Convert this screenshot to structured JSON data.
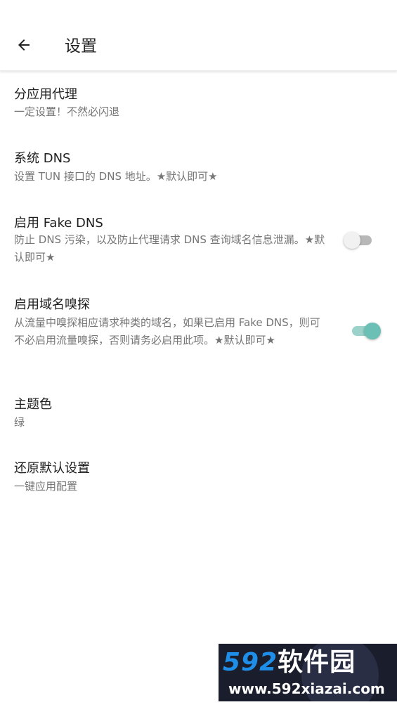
{
  "appbar": {
    "title": "设置",
    "back_icon": "arrow-left-icon"
  },
  "preferences": [
    {
      "title": "分应用代理",
      "summary": "一定设置！不然必闪退"
    },
    {
      "title": "系统 DNS",
      "summary": "设置 TUN 接口的 DNS 地址。★默认即可★"
    },
    {
      "title": "启用 Fake DNS",
      "summary": "防止 DNS 污染，以及防止代理请求 DNS 查询域名信息泄漏。★默认即可★",
      "switch_on": false
    },
    {
      "title": "启用域名嗅探",
      "summary": "从流量中嗅探相应请求种类的域名，如果已启用 Fake DNS，则可不必启用流量嗅探，否则请务必启用此项。★默认即可★",
      "switch_on": true
    },
    {
      "title": "主题色",
      "summary": "绿"
    },
    {
      "title": "还原默认设置",
      "summary": "一键应用配置"
    }
  ],
  "colors": {
    "accent": "#6cbfb5",
    "accent_track": "#9bd3cb",
    "title_text": "#1f1f1f",
    "summary_text": "#757575"
  },
  "watermark": {
    "brand_number": "592",
    "brand_text": "软件园",
    "url": "www.592xiazai.com"
  }
}
